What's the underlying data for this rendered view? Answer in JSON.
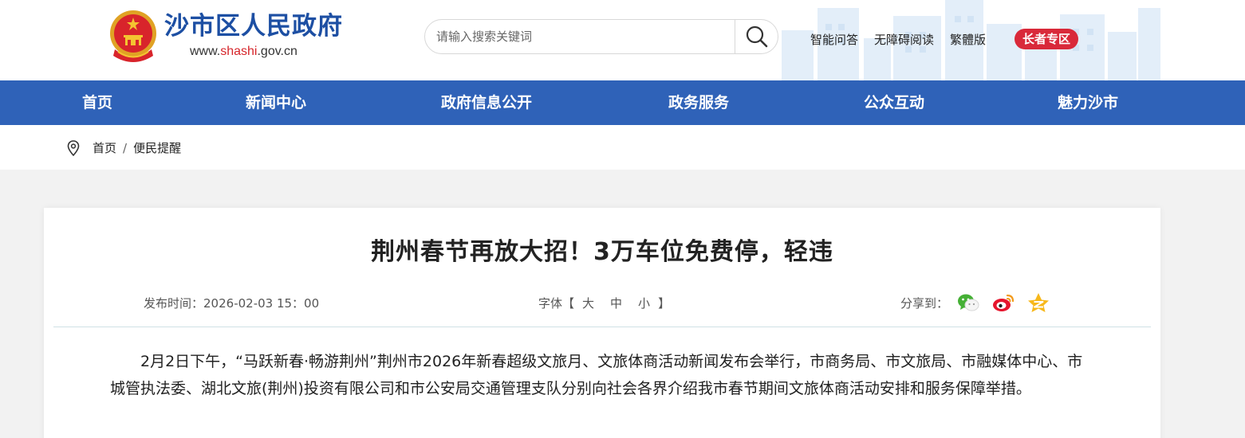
{
  "header": {
    "site_title": "沙市区人民政府",
    "site_url_prefix": "www.",
    "site_url_highlight": "shashi",
    "site_url_suffix": ".gov.cn",
    "search_placeholder": "请输入搜索关键词",
    "links": [
      "智能问答",
      "无障碍阅读",
      "繁體版"
    ],
    "elder_label": "长者专区"
  },
  "nav": {
    "items": [
      "首页",
      "新闻中心",
      "政府信息公开",
      "政务服务",
      "公众互动",
      "魅力沙市"
    ]
  },
  "breadcrumb": {
    "home": "首页",
    "separator": "/",
    "current": "便民提醒"
  },
  "article": {
    "title": "荆州春节再放大招！3万车位免费停，轻违",
    "publish_label": "发布时间：",
    "publish_time": "2026-02-03 15：00",
    "font_label": "字体【",
    "font_large": "大",
    "font_medium": "中",
    "font_small": "小",
    "font_close": "】",
    "share_label": "分享到：",
    "share_targets": [
      "wechat-icon",
      "weibo-icon",
      "qzone-icon"
    ],
    "paragraph": "2月2日下午，“马跃新春·畅游荆州”荆州市2026年新春超级文旅月、文旅体商活动新闻发布会举行，市商务局、市文旅局、市融媒体中心、市城管执法委、湖北文旅(荆州)投资有限公司和市公安局交通管理支队分别向社会各界介绍我市春节期间文旅体商活动安排和服务保障举措。"
  },
  "colors": {
    "brand_blue": "#2f62b8",
    "title_blue": "#1d4fa3",
    "accent_red": "#d9293a"
  }
}
